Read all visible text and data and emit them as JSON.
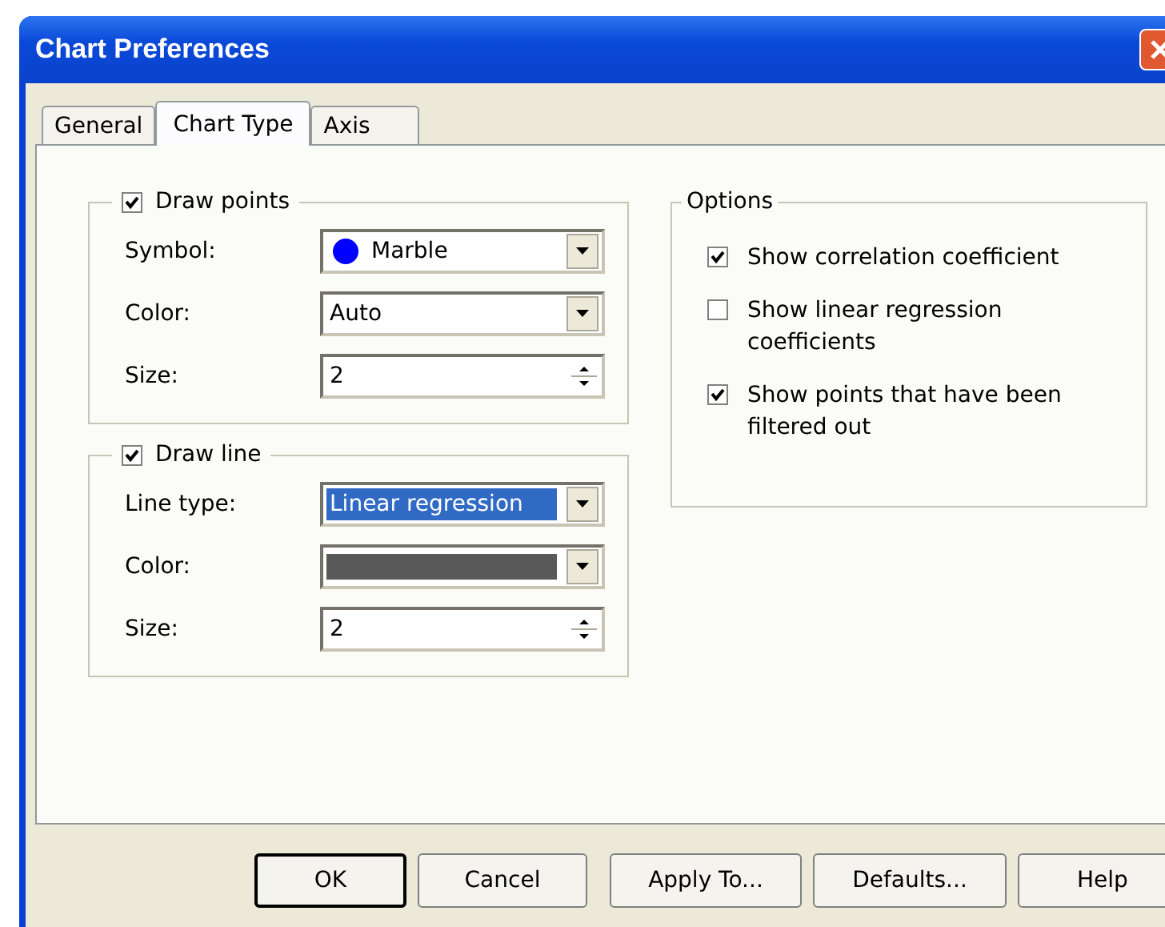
{
  "window": {
    "title": "Chart Preferences"
  },
  "tabs": [
    {
      "label": "General",
      "selected": false
    },
    {
      "label": "Chart Type",
      "selected": true
    },
    {
      "label": "Axis",
      "selected": false
    }
  ],
  "groups": [
    {
      "title": "Draw points",
      "checked": true,
      "rows": [
        {
          "label": "Symbol:",
          "kind": "symbol",
          "value": "Marble",
          "color": "#0000ff"
        },
        {
          "label": "Color:",
          "kind": "dropdown",
          "value": "Auto",
          "highlighted": false
        },
        {
          "label": "Size:",
          "kind": "spinner",
          "value": "2"
        }
      ]
    },
    {
      "title": "Draw line",
      "checked": true,
      "rows": [
        {
          "label": "Line type:",
          "kind": "dropdown",
          "value": "Linear regression",
          "highlighted": true
        },
        {
          "label": "Color:",
          "kind": "swatch",
          "color": "#595959"
        },
        {
          "label": "Size:",
          "kind": "spinner",
          "value": "2"
        }
      ]
    }
  ],
  "options": {
    "title": "Options",
    "items": [
      {
        "label": "Show correlation coefficient",
        "checked": true
      },
      {
        "label": "Show linear regression coefficients",
        "checked": false
      },
      {
        "label": "Show points that have been filtered out",
        "checked": true
      }
    ]
  },
  "buttons": [
    {
      "label": "OK",
      "default": true
    },
    {
      "label": "Cancel",
      "default": false
    },
    {
      "label": "Apply To...",
      "default": false
    },
    {
      "label": "Defaults...",
      "default": false
    },
    {
      "label": "Help",
      "default": false
    }
  ]
}
